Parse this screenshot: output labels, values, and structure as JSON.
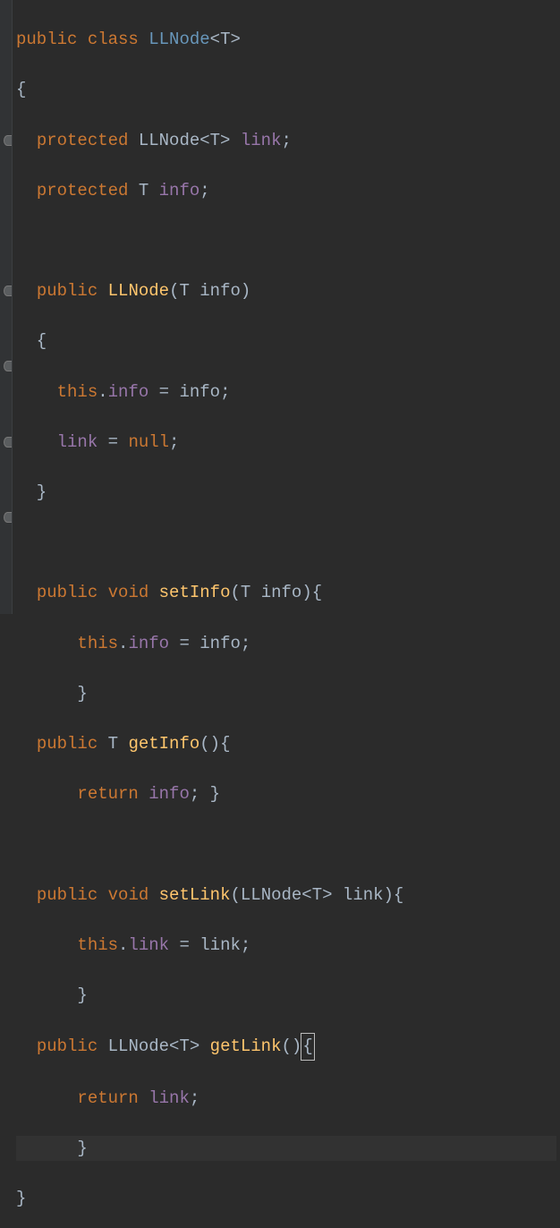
{
  "code": {
    "line1": {
      "kw1": "public",
      "kw2": "class",
      "name": "LLNode",
      "generic": "<T>"
    },
    "line2": "{",
    "line3": {
      "kw": "protected",
      "type": "LLNode<T>",
      "field": "link",
      "semi": ";"
    },
    "line4": {
      "kw": "protected",
      "type": "T",
      "field": "info",
      "semi": ";"
    },
    "line6": {
      "kw": "public",
      "name": "LLNode",
      "paren1": "(",
      "ptype": "T",
      "pname": "info",
      "paren2": ")"
    },
    "line7": "  {",
    "line8": {
      "this": "this",
      "dot": ".",
      "field": "info",
      "eq": " = ",
      "param": "info",
      "semi": ";"
    },
    "line9": {
      "field": "link",
      "eq": " = ",
      "null": "null",
      "semi": ";"
    },
    "line10": "  }",
    "line12": {
      "kw1": "public",
      "kw2": "void",
      "name": "setInfo",
      "paren1": "(",
      "ptype": "T",
      "pname": "info",
      "paren2": "){"
    },
    "line13": {
      "this": "this",
      "dot": ".",
      "field": "info",
      "eq": " = ",
      "param": "info",
      "semi": ";"
    },
    "line14": "      }",
    "line15": {
      "kw1": "public",
      "ret": "T",
      "name": "getInfo",
      "parens": "(){"
    },
    "line16": {
      "kw": "return",
      "field": "info",
      "semi": "; }"
    },
    "line18": {
      "kw1": "public",
      "kw2": "void",
      "name": "setLink",
      "paren1": "(",
      "ptype": "LLNode<T>",
      "pname": "link",
      "paren2": "){"
    },
    "line19": {
      "this": "this",
      "dot": ".",
      "field": "link",
      "eq": " = ",
      "param": "link",
      "semi": ";"
    },
    "line20": "      }",
    "line21": {
      "kw1": "public",
      "ret": "LLNode<T>",
      "name": "getLink",
      "p1": "()",
      "cursor": "{"
    },
    "line22": {
      "kw": "return",
      "field": "link",
      "semi": ";"
    },
    "line23": "      }",
    "line24": "}"
  }
}
